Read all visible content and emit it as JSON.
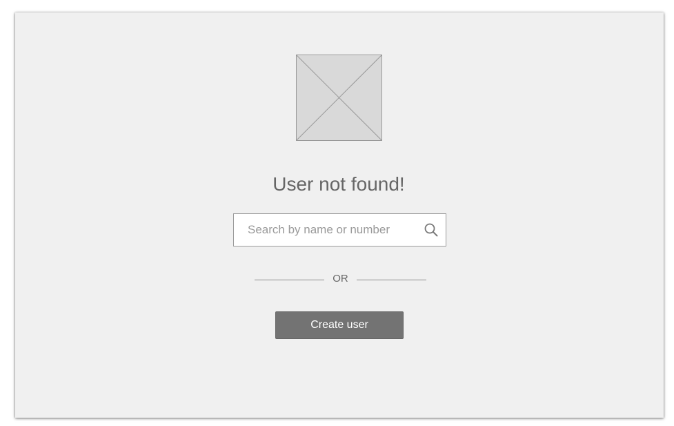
{
  "empty_state": {
    "title": "User not found!",
    "image_icon": "image-placeholder-icon"
  },
  "search": {
    "placeholder": "Search by name or number",
    "value": "",
    "icon": "search-icon"
  },
  "divider": {
    "label": "OR"
  },
  "actions": {
    "create_label": "Create user"
  },
  "colors": {
    "panel_background": "#f0f0f0",
    "placeholder_fill": "#d9d9d9",
    "text": "#666666",
    "button": "#737373",
    "button_text": "#ffffff"
  }
}
